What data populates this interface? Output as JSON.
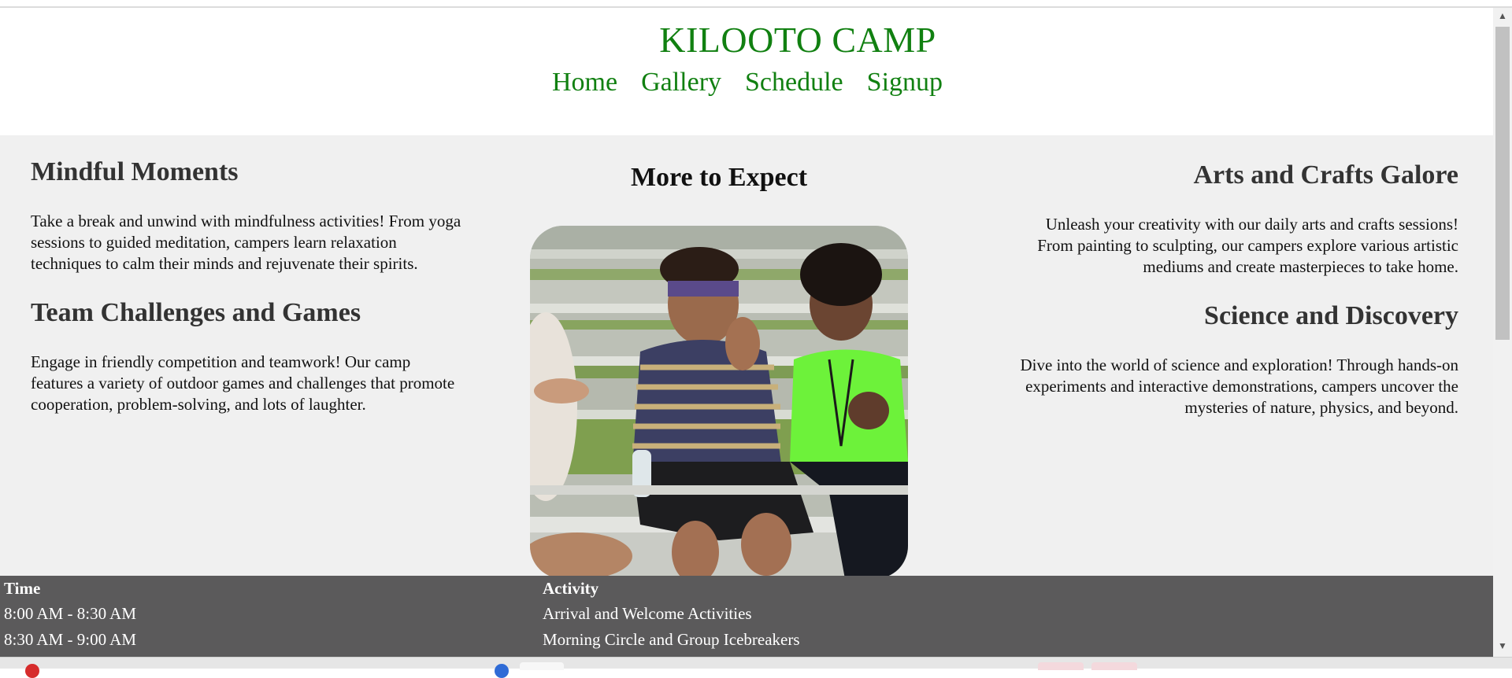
{
  "header": {
    "title": "KILOOTO CAMP",
    "nav": [
      "Home",
      "Gallery",
      "Schedule",
      "Signup"
    ]
  },
  "left": {
    "sections": [
      {
        "heading": "Mindful Moments",
        "body": "Take a break and unwind with mindfulness activities! From yoga sessions to guided meditation, campers learn relaxation techniques to calm their minds and rejuvenate their spirits."
      },
      {
        "heading": "Team Challenges and Games",
        "body": "Engage in friendly competition and teamwork! Our camp features a variety of outdoor games and challenges that promote cooperation, problem-solving, and lots of laughter."
      }
    ]
  },
  "center": {
    "heading": "More to Expect",
    "image_icon": "camp-kids-photo"
  },
  "right": {
    "sections": [
      {
        "heading": "Arts and Crafts Galore",
        "body": "Unleash your creativity with our daily arts and crafts sessions! From painting to sculpting, our campers explore various artistic mediums and create masterpieces to take home."
      },
      {
        "heading": "Science and Discovery",
        "body": "Dive into the world of science and exploration! Through hands-on experiments and interactive demonstrations, campers uncover the mysteries of nature, physics, and beyond."
      }
    ]
  },
  "schedule": {
    "headers": [
      "Time",
      "Activity"
    ],
    "rows": [
      [
        "8:00 AM - 8:30 AM",
        "Arrival and Welcome Activities"
      ],
      [
        "8:30 AM - 9:00 AM",
        "Morning Circle and Group Icebreakers"
      ]
    ]
  },
  "colors": {
    "brand_green": "#118011",
    "main_bg": "#f0f0f0",
    "schedule_bg": "#5b5a5b"
  }
}
